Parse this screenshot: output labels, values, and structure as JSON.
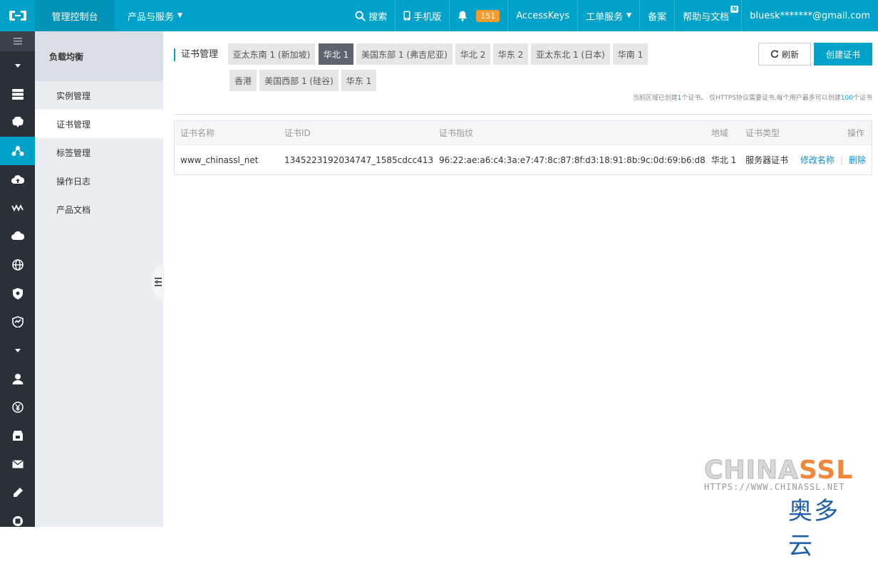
{
  "topbar": {
    "console": "管理控制台",
    "products": "产品与服务",
    "search": "搜索",
    "mobile": "手机版",
    "notifications_count": "151",
    "access_keys": "AccessKeys",
    "ticket": "工单服务",
    "beian": "备案",
    "help": "帮助与文档",
    "help_badge": "N",
    "account": "bluesk*******@gmail.com"
  },
  "iconbar": {
    "icons": [
      "menu-icon",
      "caret-down-icon",
      "server-icon",
      "cloud-db-icon",
      "load-balance-icon",
      "cloud-upload-icon",
      "network-wave-icon",
      "cloud-storage-icon",
      "globe-icon",
      "shield-icon",
      "monitor-icon",
      "caret-down-icon",
      "user-icon",
      "yen-icon",
      "package-icon",
      "mail-icon",
      "edit-icon",
      "chip-icon"
    ]
  },
  "subnav": {
    "title": "负载均衡",
    "items": [
      "实例管理",
      "证书管理",
      "标签管理",
      "操作日志",
      "产品文档"
    ]
  },
  "main": {
    "page_title": "证书管理",
    "regions_row1": [
      "亚太东南 1 (新加坡)",
      "华北 1",
      "美国东部 1 (弗吉尼亚)",
      "华北 2",
      "华东 2",
      "亚太东北 1 (日本)",
      "华南 1"
    ],
    "regions_row2": [
      "香港",
      "美国西部 1 (硅谷)",
      "华东 1"
    ],
    "active_region": "华北 1",
    "refresh": "刷新",
    "create": "创建证书",
    "hint_a": "当前区域已创建",
    "hint_count": "1",
    "hint_b": "个证书。 仅HTTPS协议需要证书,每个用户最多可以创建",
    "hint_max": "100",
    "hint_c": "个证书"
  },
  "table": {
    "headers": [
      "证书名称",
      "证书ID",
      "证书指纹",
      "地域",
      "证书类型",
      "操作"
    ],
    "rows": [
      {
        "name": "www_chinassl_net",
        "id": "1345223192034747_1585cdcc413",
        "fingerprint": "96:22:ae:a6:c4:3a:e7:47:8c:87:8f:d3:18:91:8b:9c:0d:69:b6:d8",
        "region": "华北 1",
        "type": "服务器证书",
        "action_rename": "修改名称",
        "action_delete": "删除"
      }
    ]
  },
  "watermark": {
    "brand_a": "CHINA",
    "brand_b": "SSL",
    "url": "HTTPS://WWW.CHINASSL.NET",
    "cn": "奥多云"
  },
  "colors": {
    "primary": "#00a2ca",
    "sidebar": "#293038",
    "subnav": "#eaedf1",
    "link": "#0b8dd2",
    "badge": "#f39b2b"
  }
}
